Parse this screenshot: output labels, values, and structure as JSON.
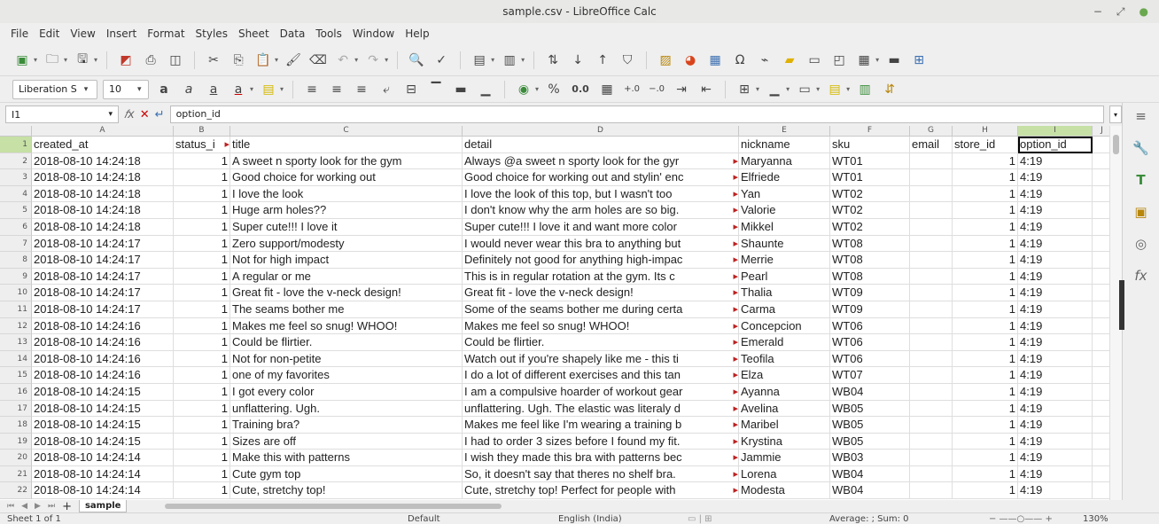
{
  "window": {
    "title": "sample.csv - LibreOffice Calc",
    "controls": [
      "−",
      "⤢",
      "●"
    ]
  },
  "menu": [
    "File",
    "Edit",
    "View",
    "Insert",
    "Format",
    "Styles",
    "Sheet",
    "Data",
    "Tools",
    "Window",
    "Help"
  ],
  "toolbar2": {
    "font_name": "Liberation S",
    "font_size": "10",
    "number_format": "0.0"
  },
  "formula_bar": {
    "name_box": "I1",
    "content": "option_id"
  },
  "columns": [
    "A",
    "B",
    "C",
    "D",
    "E",
    "F",
    "G",
    "H",
    "I",
    "J"
  ],
  "header_row": [
    "created_at",
    "status_i",
    "title",
    "detail",
    "nickname",
    "sku",
    "email",
    "store_id",
    "option_id"
  ],
  "rows": [
    {
      "n": "2",
      "a": "2018-08-10 14:24:18",
      "b": "1",
      "c": "A sweet n sporty look for the gym",
      "d": "Always @a sweet n sporty look for the gyr",
      "e": "Maryanna",
      "f": "WT01",
      "h": "1",
      "i": "4:19"
    },
    {
      "n": "3",
      "a": "2018-08-10 14:24:18",
      "b": "1",
      "c": "Good choice for working out",
      "d": "Good choice for working out and stylin' enc",
      "e": "Elfriede",
      "f": "WT01",
      "h": "1",
      "i": "4:19"
    },
    {
      "n": "4",
      "a": "2018-08-10 14:24:18",
      "b": "1",
      "c": "I love the look",
      "d": "I love the look of this top, but I wasn't too",
      "e": "Yan",
      "f": "WT02",
      "h": "1",
      "i": "4:19"
    },
    {
      "n": "5",
      "a": "2018-08-10 14:24:18",
      "b": "1",
      "c": "Huge arm holes??",
      "d": "I don't know why the arm holes are so big.",
      "e": "Valorie",
      "f": "WT02",
      "h": "1",
      "i": "4:19"
    },
    {
      "n": "6",
      "a": "2018-08-10 14:24:18",
      "b": "1",
      "c": "Super cute!!!  I love it",
      "d": "Super cute!!!  I love it and want more color",
      "e": "Mikkel",
      "f": "WT02",
      "h": "1",
      "i": "4:19"
    },
    {
      "n": "7",
      "a": "2018-08-10 14:24:17",
      "b": "1",
      "c": "Zero support/modesty",
      "d": "I would never wear this bra to anything but",
      "e": "Shaunte",
      "f": "WT08",
      "h": "1",
      "i": "4:19"
    },
    {
      "n": "8",
      "a": "2018-08-10 14:24:17",
      "b": "1",
      "c": "Not for high impact",
      "d": "Definitely not good for anything high-impac",
      "e": "Merrie",
      "f": "WT08",
      "h": "1",
      "i": "4:19"
    },
    {
      "n": "9",
      "a": "2018-08-10 14:24:17",
      "b": "1",
      "c": "A regular or me",
      "d": "This is in regular rotation at the gym. Its c",
      "e": "Pearl",
      "f": "WT08",
      "h": "1",
      "i": "4:19"
    },
    {
      "n": "10",
      "a": "2018-08-10 14:24:17",
      "b": "1",
      "c": "Great fit - love the v-neck design!",
      "d": "Great fit - love the v-neck design!",
      "e": "Thalia",
      "f": "WT09",
      "h": "1",
      "i": "4:19"
    },
    {
      "n": "11",
      "a": "2018-08-10 14:24:17",
      "b": "1",
      "c": "The seams bother me",
      "d": "Some of the seams bother me during certa",
      "e": "Carma",
      "f": "WT09",
      "h": "1",
      "i": "4:19"
    },
    {
      "n": "12",
      "a": "2018-08-10 14:24:16",
      "b": "1",
      "c": "Makes me feel so snug! WHOO!",
      "d": "Makes me feel so snug! WHOO!",
      "e": "Concepcion",
      "f": "WT06",
      "h": "1",
      "i": "4:19"
    },
    {
      "n": "13",
      "a": "2018-08-10 14:24:16",
      "b": "1",
      "c": "Could be flirtier.",
      "d": "Could be flirtier.",
      "e": "Emerald",
      "f": "WT06",
      "h": "1",
      "i": "4:19"
    },
    {
      "n": "14",
      "a": "2018-08-10 14:24:16",
      "b": "1",
      "c": "Not for non-petite",
      "d": "Watch out if you're shapely like me - this ti",
      "e": "Teofila",
      "f": "WT06",
      "h": "1",
      "i": "4:19"
    },
    {
      "n": "15",
      "a": "2018-08-10 14:24:16",
      "b": "1",
      "c": "one of my favorites",
      "d": "I do a lot of different exercises and this tan",
      "e": "Elza",
      "f": "WT07",
      "h": "1",
      "i": "4:19"
    },
    {
      "n": "16",
      "a": "2018-08-10 14:24:15",
      "b": "1",
      "c": "I got every color",
      "d": "I am a compulsive hoarder of workout gear",
      "e": "Ayanna",
      "f": "WB04",
      "h": "1",
      "i": "4:19"
    },
    {
      "n": "17",
      "a": "2018-08-10 14:24:15",
      "b": "1",
      "c": "unflattering. Ugh.",
      "d": "unflattering. Ugh. The elastic was literaly d",
      "e": "Avelina",
      "f": "WB05",
      "h": "1",
      "i": "4:19"
    },
    {
      "n": "18",
      "a": "2018-08-10 14:24:15",
      "b": "1",
      "c": "Training bra?",
      "d": "Makes me feel like I'm wearing a training b",
      "e": "Maribel",
      "f": "WB05",
      "h": "1",
      "i": "4:19"
    },
    {
      "n": "19",
      "a": "2018-08-10 14:24:15",
      "b": "1",
      "c": "Sizes are off",
      "d": "I had to order 3 sizes before I found my fit.",
      "e": "Krystina",
      "f": "WB05",
      "h": "1",
      "i": "4:19"
    },
    {
      "n": "20",
      "a": "2018-08-10 14:24:14",
      "b": "1",
      "c": "Make this with patterns",
      "d": "I wish they made this bra with patterns bec",
      "e": "Jammie",
      "f": "WB03",
      "h": "1",
      "i": "4:19"
    },
    {
      "n": "21",
      "a": "2018-08-10 14:24:14",
      "b": "1",
      "c": "Cute gym top",
      "d": "So, it doesn't say that theres no shelf bra.",
      "e": "Lorena",
      "f": "WB04",
      "h": "1",
      "i": "4:19"
    },
    {
      "n": "22",
      "a": "2018-08-10 14:24:14",
      "b": "1",
      "c": "Cute, stretchy top!",
      "d": "Cute, stretchy top! Perfect for people with",
      "e": "Modesta",
      "f": "WB04",
      "h": "1",
      "i": "4:19"
    }
  ],
  "sheet_tabs": [
    "sample"
  ],
  "status": {
    "sheet": "Sheet 1 of 1",
    "style": "Default",
    "language": "English (India)",
    "summary": "Average: ; Sum: 0",
    "zoom": "130%"
  },
  "colors": {
    "selected_header": "#c6e0a5",
    "clip_marker": "#b22222"
  }
}
